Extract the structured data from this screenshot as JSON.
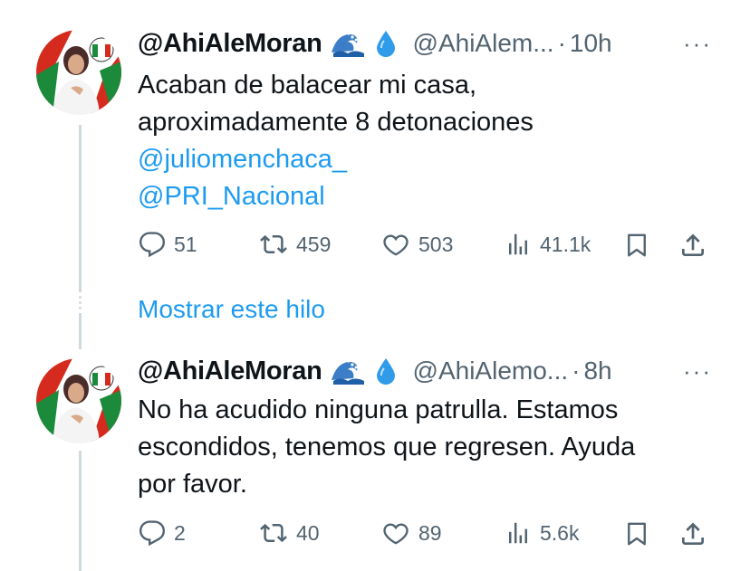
{
  "tweets": [
    {
      "name": "@AhiAleMoran",
      "handle": "@AhiAlem...",
      "separator": "·",
      "time": "10h",
      "more": "···",
      "lines": [
        {
          "text": "Acaban de balacear mi casa,",
          "mention": false
        },
        {
          "text": "aproximadamente 8 detonaciones",
          "mention": false
        },
        {
          "text": "@juliomenchaca_",
          "mention": true
        },
        {
          "text": "@PRI_Nacional",
          "mention": true
        }
      ],
      "replies": "51",
      "retweets": "459",
      "likes": "503",
      "views": "41.1k"
    },
    {
      "name": "@AhiAleMoran",
      "handle": "@AhiAlemo...",
      "separator": "·",
      "time": "8h",
      "more": "···",
      "lines": [
        {
          "text": "No ha acudido ninguna patrulla. Estamos",
          "mention": false
        },
        {
          "text": "escondidos, tenemos que regresen. Ayuda",
          "mention": false
        },
        {
          "text": "por favor.",
          "mention": false
        }
      ],
      "replies": "2",
      "retweets": "40",
      "likes": "89",
      "views": "5.6k"
    }
  ],
  "show_thread": "Mostrar este hilo",
  "colors": {
    "link": "#1d9bf0",
    "muted": "#536471",
    "text": "#0f1419",
    "thread_line": "#cfd9de",
    "pri_red": "#d52b1e",
    "pri_green": "#1b8a3a"
  },
  "icons": [
    "wave-emoji-icon",
    "droplet-emoji-icon",
    "reply-icon",
    "retweet-icon",
    "like-icon",
    "views-icon",
    "bookmark-icon",
    "share-icon"
  ]
}
